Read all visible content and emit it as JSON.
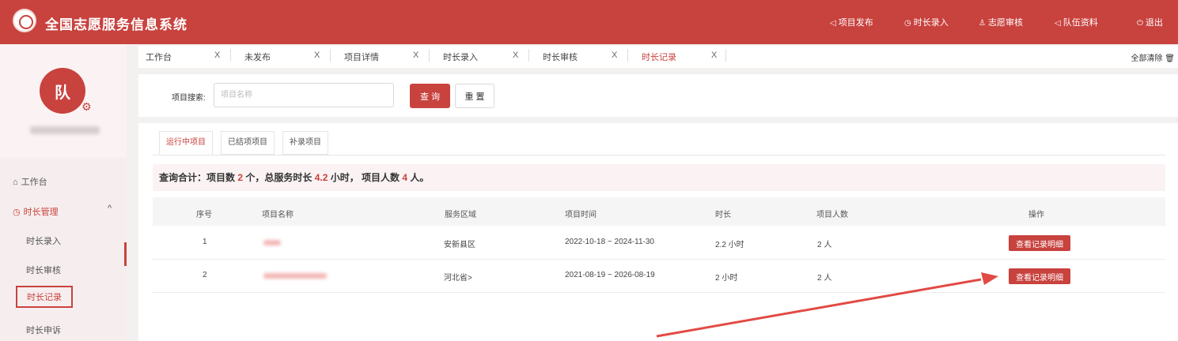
{
  "header": {
    "title": "全国志愿服务信息系统",
    "nav": [
      {
        "icon": "send-icon",
        "glyph": "◁",
        "label": "项目发布"
      },
      {
        "icon": "clock-icon",
        "glyph": "◷",
        "label": "时长录入"
      },
      {
        "icon": "user-icon",
        "glyph": "♙",
        "label": "志愿审核"
      },
      {
        "icon": "send-icon",
        "glyph": "◁",
        "label": "队伍资料"
      },
      {
        "icon": "power-icon",
        "glyph": "⏻",
        "label": "退出"
      }
    ]
  },
  "sidebar": {
    "avatar_text": "队",
    "nav": [
      {
        "icon": "home-icon",
        "glyph": "⌂",
        "label": "工作台"
      },
      {
        "icon": "clock-icon",
        "glyph": "◷",
        "label": "时长管理",
        "chevron": "^"
      }
    ],
    "sub_items": [
      "时长录入",
      "时长审核",
      "时长记录",
      "时长申诉"
    ],
    "active_sub": "时长记录"
  },
  "tabs": {
    "items": [
      {
        "label": "工作台",
        "close": "X"
      },
      {
        "label": "未发布",
        "close": "X"
      },
      {
        "label": "项目详情",
        "close": "X"
      },
      {
        "label": "时长录入",
        "close": "X"
      },
      {
        "label": "时长审核",
        "close": "X"
      },
      {
        "label": "时长记录",
        "close": "X",
        "active": true
      }
    ],
    "clear_all": "全部清除"
  },
  "search": {
    "label": "项目搜索:",
    "placeholder": "项目名称",
    "value": "",
    "query_button": "查 询",
    "reset_button": "重 置"
  },
  "panel_tabs": [
    "运行中项目",
    "已结项项目",
    "补录项目"
  ],
  "summary": {
    "prefix": "查询合计：项目数 ",
    "project_count": "2",
    "mid1": " 个，总服务时长 ",
    "total_hours": "4.2",
    "mid2": " 小时， 项目人数 ",
    "people_count": "4",
    "suffix": " 人。"
  },
  "table": {
    "columns": [
      "序号",
      "项目名称",
      "服务区域",
      "项目时间",
      "时长",
      "项目人数",
      "操作"
    ],
    "rows": [
      {
        "index": "1",
        "area": "安新县区",
        "time": "2022-10-18 ~ 2024-11-30",
        "duration": "2.2 小时",
        "people": "2 人",
        "action": "查看记录明细"
      },
      {
        "index": "2",
        "area": "河北省>",
        "time": "2021-08-19 ~ 2026-08-19",
        "duration": "2 小时",
        "people": "2 人",
        "action": "查看记录明细"
      }
    ]
  },
  "colors": {
    "brand": "#c8423e",
    "annotation_arrow": "#e24a44"
  }
}
